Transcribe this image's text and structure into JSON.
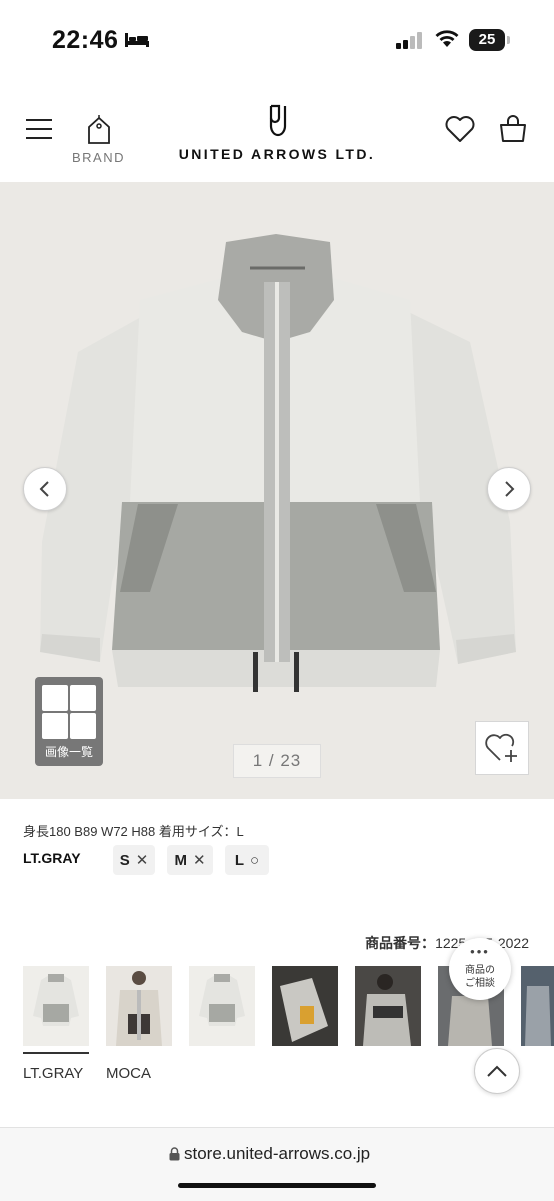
{
  "status_bar": {
    "time": "22:46",
    "battery": "25"
  },
  "header": {
    "brand_label": "BRAND",
    "logo_text": "UNITED ARROWS LTD."
  },
  "gallery": {
    "image_list_label": "画像一覧",
    "counter": "1 / 23"
  },
  "product": {
    "model_info": "身長180 B89 W72 H88 着用サイズ：L",
    "color": "LT.GRAY",
    "sizes": [
      {
        "label": "S",
        "mark": "✕"
      },
      {
        "label": "M",
        "mark": "✕"
      },
      {
        "label": "L",
        "mark": "○"
      }
    ],
    "number_label": "商品番号：",
    "number_value": "1225-115-2022"
  },
  "thumbnails": {
    "labels": [
      "LT.GRAY",
      "MOCA"
    ]
  },
  "consult": {
    "dots": "•••",
    "line1": "商品の",
    "line2": "ご相談"
  },
  "browser": {
    "url": "store.united-arrows.co.jp"
  },
  "colors": {
    "hero_bg": "#ebe9e5",
    "jacket_light": "#e6e6e2",
    "jacket_gray": "#a6a8a3"
  }
}
